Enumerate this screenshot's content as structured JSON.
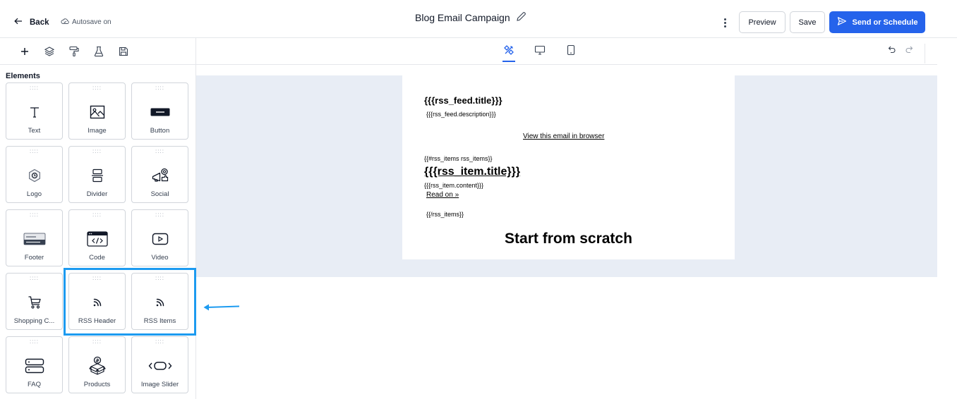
{
  "header": {
    "back_label": "Back",
    "autosave_label": "Autosave on",
    "title": "Blog Email Campaign",
    "preview_label": "Preview",
    "save_label": "Save",
    "send_label": "Send or Schedule",
    "accent_color": "#2563eb"
  },
  "toolbar": {
    "left_icons": [
      "plus-icon",
      "layers-icon",
      "paint-roller-icon",
      "flask-icon",
      "save-icon"
    ],
    "view_tabs": [
      "design-tools-icon",
      "desktop-icon",
      "mobile-icon"
    ],
    "active_tab": "design-tools-icon",
    "history_icons": [
      "undo-icon",
      "redo-icon"
    ]
  },
  "sidebar": {
    "title": "Elements",
    "elements": [
      {
        "label": "Text",
        "icon": "text-icon"
      },
      {
        "label": "Image",
        "icon": "image-icon"
      },
      {
        "label": "Button",
        "icon": "button-icon"
      },
      {
        "label": "Logo",
        "icon": "logo-icon"
      },
      {
        "label": "Divider",
        "icon": "divider-icon"
      },
      {
        "label": "Social",
        "icon": "social-icon"
      },
      {
        "label": "Footer",
        "icon": "footer-icon"
      },
      {
        "label": "Code",
        "icon": "code-icon"
      },
      {
        "label": "Video",
        "icon": "video-icon"
      },
      {
        "label": "Shopping C...",
        "icon": "cart-icon"
      },
      {
        "label": "RSS Header",
        "icon": "rss-icon"
      },
      {
        "label": "RSS Items",
        "icon": "rss-icon"
      },
      {
        "label": "FAQ",
        "icon": "faq-icon"
      },
      {
        "label": "Products",
        "icon": "products-icon"
      },
      {
        "label": "Image Slider",
        "icon": "slider-icon"
      }
    ],
    "highlight_color": "#1d9bf0"
  },
  "email": {
    "feed_title": "{{{rss_feed.title}}}",
    "feed_description": "{{{rss_feed.description}}}",
    "view_in_browser": "View this email in browser",
    "items_open": "{{#rss_items rss_items}}",
    "item_title": "{{{rss_item.title}}}",
    "item_content": "{{{rss_item.content}}}",
    "read_on": "Read on »",
    "items_close": "{{/rss_items}}",
    "start_from_scratch": "Start from scratch"
  }
}
